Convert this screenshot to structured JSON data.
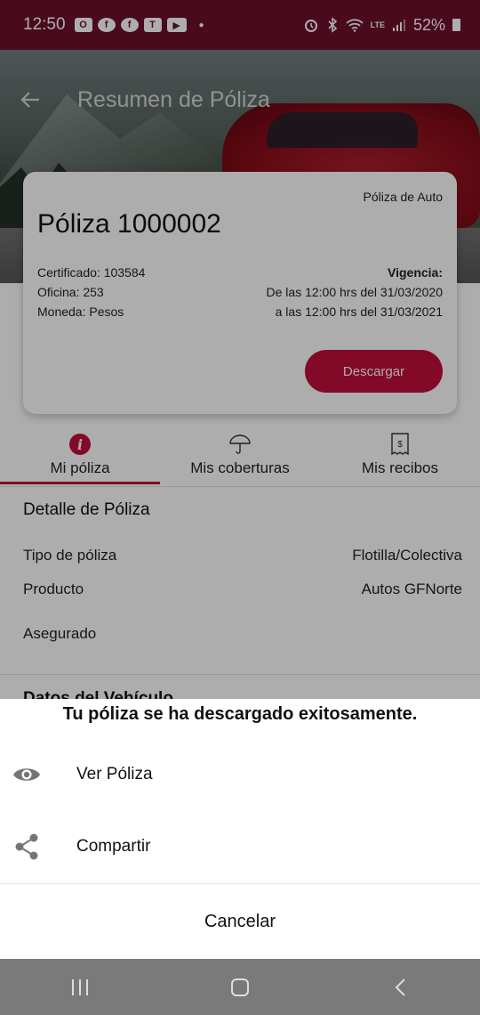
{
  "status_bar": {
    "time": "12:50",
    "battery": "52%",
    "notification_icons": [
      "outlook-icon",
      "facebook-icon",
      "facebook-icon",
      "teams-icon",
      "youtube-icon"
    ],
    "system_icons": [
      "alarm-icon",
      "bluetooth-icon",
      "wifi-icon",
      "lte-icon",
      "signal-icon",
      "battery-icon"
    ],
    "lte_label": "LTE"
  },
  "header": {
    "title": "Resumen de Póliza"
  },
  "policy_card": {
    "type": "Póliza de Auto",
    "title": "Póliza 1000002",
    "certificado": "Certificado: 103584",
    "oficina": "Oficina: 253",
    "moneda": "Moneda: Pesos",
    "vigencia_label": "Vigencia:",
    "vigencia_from": "De las 12:00 hrs del 31/03/2020",
    "vigencia_to": "a las 12:00 hrs del 31/03/2021",
    "download_label": "Descargar"
  },
  "tabs": [
    {
      "label": "Mi póliza",
      "icon": "info-icon",
      "active": true,
      "icon_glyph": "i"
    },
    {
      "label": "Mis coberturas",
      "icon": "umbrella-icon",
      "active": false
    },
    {
      "label": "Mis recibos",
      "icon": "receipt-icon",
      "active": false,
      "icon_glyph": "$"
    }
  ],
  "detail": {
    "title": "Detalle de Póliza",
    "rows": [
      {
        "label": "Tipo de póliza",
        "value": "Flotilla/Colectiva"
      },
      {
        "label": "Producto",
        "value": "Autos GFNorte"
      },
      {
        "label": "Asegurado",
        "value": ""
      }
    ],
    "next_section_partial": "Datos del Vehículo"
  },
  "sheet": {
    "title": "Tu póliza se ha descargado exitosamente.",
    "view_label": "Ver Póliza",
    "share_label": "Compartir",
    "cancel_label": "Cancelar"
  },
  "colors": {
    "brand": "#c10e3b",
    "status_bar": "#6e0f2c"
  }
}
